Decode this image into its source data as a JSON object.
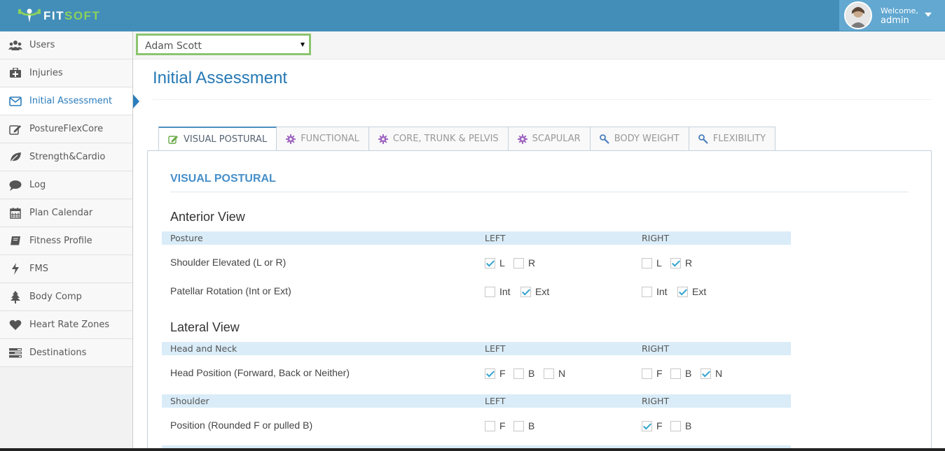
{
  "header": {
    "logo_fit": "FIT",
    "logo_soft": "SOFT",
    "welcome": "Welcome,",
    "username": "admin"
  },
  "sidebar": {
    "items": [
      {
        "label": "Users",
        "icon": "users-icon"
      },
      {
        "label": "Injuries",
        "icon": "medkit-icon"
      },
      {
        "label": "Initial Assessment",
        "icon": "envelope-icon",
        "active": true
      },
      {
        "label": "PostureFlexCore",
        "icon": "edit-icon"
      },
      {
        "label": "Strength&Cardio",
        "icon": "leaf-icon"
      },
      {
        "label": "Log",
        "icon": "comment-icon"
      },
      {
        "label": "Plan Calendar",
        "icon": "calendar-icon"
      },
      {
        "label": "Fitness Profile",
        "icon": "book-icon"
      },
      {
        "label": "FMS",
        "icon": "bolt-icon"
      },
      {
        "label": "Body Comp",
        "icon": "tree-icon"
      },
      {
        "label": "Heart Rate Zones",
        "icon": "heart-icon"
      },
      {
        "label": "Destinations",
        "icon": "tasks-icon"
      }
    ]
  },
  "client_select": {
    "value": "Adam Scott"
  },
  "page_title": "Initial Assessment",
  "tabs": [
    {
      "label": "VISUAL POSTURAL",
      "icon": "edit-icon",
      "active": true
    },
    {
      "label": "FUNCTIONAL",
      "icon": "gear-icon"
    },
    {
      "label": "CORE, TRUNK & PELVIS",
      "icon": "gear-icon"
    },
    {
      "label": "SCAPULAR",
      "icon": "gear-icon"
    },
    {
      "label": "BODY WEIGHT",
      "icon": "wrench-icon"
    },
    {
      "label": "FLEXIBILITY",
      "icon": "wrench-icon"
    }
  ],
  "section_heading": "VISUAL POSTURAL",
  "anterior": {
    "title": "Anterior View",
    "band": {
      "label": "Posture",
      "left": "LEFT",
      "right": "RIGHT"
    },
    "shoulder": {
      "label": "Shoulder Elevated (L or R)",
      "left": [
        {
          "t": "L",
          "checked": true
        },
        {
          "t": "R",
          "checked": false
        }
      ],
      "right": [
        {
          "t": "L",
          "checked": false
        },
        {
          "t": "R",
          "checked": true
        }
      ]
    },
    "patellar": {
      "label": "Patellar Rotation (Int or Ext)",
      "left": [
        {
          "t": "Int",
          "checked": false
        },
        {
          "t": "Ext",
          "checked": true
        }
      ],
      "right": [
        {
          "t": "Int",
          "checked": false
        },
        {
          "t": "Ext",
          "checked": true
        }
      ]
    }
  },
  "lateral": {
    "title": "Lateral View",
    "band1": {
      "label": "Head and Neck",
      "left": "LEFT",
      "right": "RIGHT"
    },
    "head": {
      "label": "Head Position (Forward, Back or Neither)",
      "left": [
        {
          "t": "F",
          "checked": true
        },
        {
          "t": "B",
          "checked": false
        },
        {
          "t": "N",
          "checked": false
        }
      ],
      "right": [
        {
          "t": "F",
          "checked": false
        },
        {
          "t": "B",
          "checked": false
        },
        {
          "t": "N",
          "checked": true
        }
      ]
    },
    "band2": {
      "label": "Shoulder",
      "left": "LEFT",
      "right": "RIGHT"
    },
    "position": {
      "label": "Position (Rounded F or pulled B)",
      "left": [
        {
          "t": "F",
          "checked": false
        },
        {
          "t": "B",
          "checked": false
        }
      ],
      "right": [
        {
          "t": "F",
          "checked": true
        },
        {
          "t": "B",
          "checked": false
        }
      ]
    }
  },
  "colors": {
    "header": "#438eb9",
    "accent": "#2b7dbc",
    "logo_green": "#8bd15c",
    "check": "#32a3ce"
  }
}
